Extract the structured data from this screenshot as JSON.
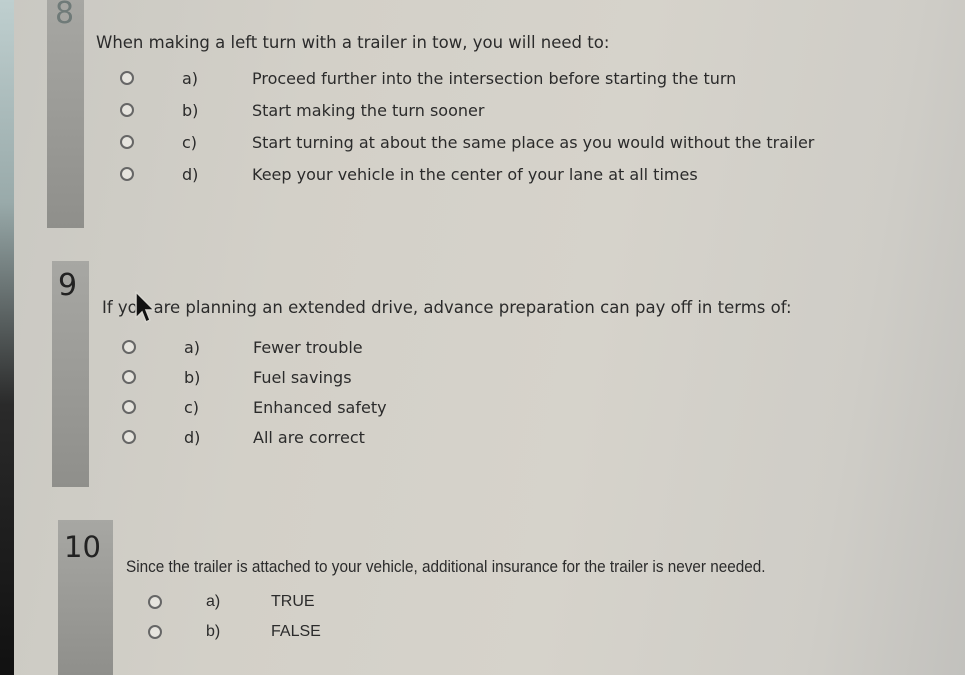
{
  "questions": [
    {
      "number": "8",
      "text": "When making a left turn with a trailer in tow, you will need to:",
      "options": [
        {
          "letter": "a)",
          "text": "Proceed further into the intersection before starting the turn",
          "selected": false
        },
        {
          "letter": "b)",
          "text": "Start making the turn sooner",
          "selected": false
        },
        {
          "letter": "c)",
          "text": "Start turning at about the same place as you would without the trailer",
          "selected": false
        },
        {
          "letter": "d)",
          "text": "Keep your vehicle in the center of your lane at all times",
          "selected": false
        }
      ]
    },
    {
      "number": "9",
      "text": "If you are planning an extended drive, advance preparation can pay off in terms of:",
      "options": [
        {
          "letter": "a)",
          "text": "Fewer trouble",
          "selected": false
        },
        {
          "letter": "b)",
          "text": "Fuel savings",
          "selected": false
        },
        {
          "letter": "c)",
          "text": "Enhanced safety",
          "selected": false
        },
        {
          "letter": "d)",
          "text": "All are correct",
          "selected": false
        }
      ]
    },
    {
      "number": "10",
      "text": "Since the trailer is attached to your vehicle, additional insurance for the trailer is never needed.",
      "options": [
        {
          "letter": "a)",
          "text": "TRUE",
          "selected": false
        },
        {
          "letter": "b)",
          "text": "FALSE",
          "selected": false
        }
      ]
    }
  ],
  "colors": {
    "background": "#d3d0c8",
    "number_bar": "#9a9a96",
    "text": "#2b2b2b"
  }
}
